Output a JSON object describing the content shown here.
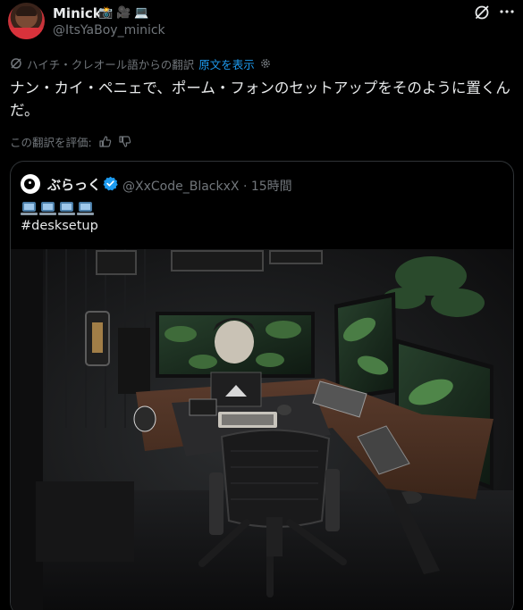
{
  "post": {
    "author": {
      "name": "Minick",
      "emojis": [
        "📸",
        "🎥",
        "💻"
      ],
      "handle": "@ItsYaBoy_minick"
    },
    "translation": {
      "notice": "ハイチ・クレオール語からの翻訳",
      "show_original": "原文を表示"
    },
    "text": "ナン・カイ・ペニェで、ポーム・フォンのセットアップをそのように置くんだ。",
    "rate_translation": "この翻訳を評価:"
  },
  "quoted": {
    "author": {
      "name": "ぶらっく",
      "handle": "@XxCode_BlackxX",
      "separator": "·",
      "time": "15時間"
    },
    "emoji_count": 4,
    "hashtag": "#desksetup",
    "image": {
      "subject": "dark desk setup with three monitors, plants and an ergonomic chair"
    }
  },
  "colors": {
    "background": "#000000",
    "text_primary": "#e7e9ea",
    "text_secondary": "#71767b",
    "link": "#1d9bf0",
    "border": "#2f3336",
    "verified": "#1d9bf0"
  },
  "icons": [
    "grok-icon",
    "more-icon",
    "translate-icon",
    "settings-icon",
    "thumbs-up-icon",
    "thumbs-down-icon",
    "verified-badge-icon",
    "laptop-icon"
  ]
}
